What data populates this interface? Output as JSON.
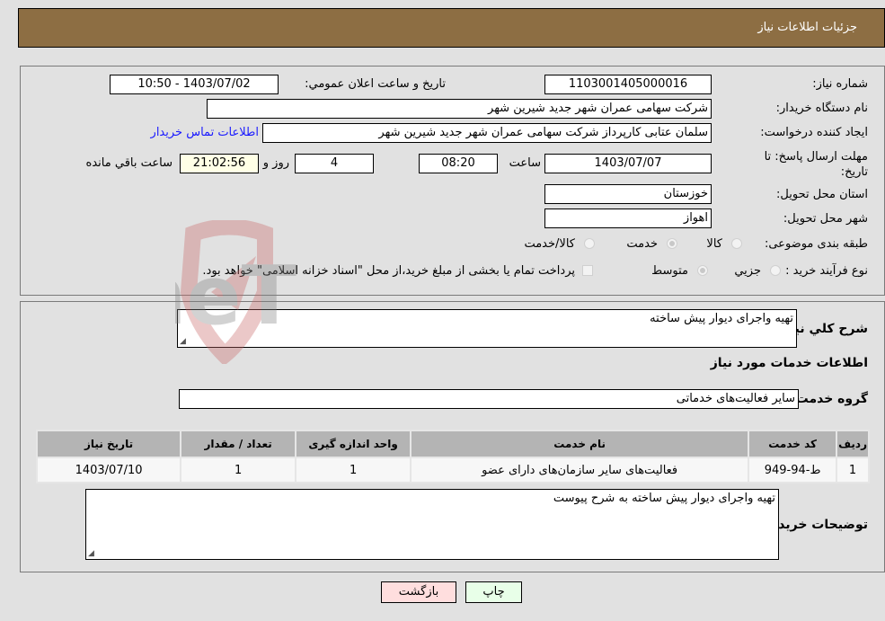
{
  "header": {
    "title": "جزئیات اطلاعات نیاز"
  },
  "need": {
    "number_label": "شماره نیاز:",
    "number": "1103001405000016",
    "announce_label": "تاریخ و ساعت اعلان عمومي:",
    "announce": "1403/07/02 - 10:50",
    "buyer_label": "نام دستگاه خریدار:",
    "buyer": "شرکت سهامی عمران شهر جدید شیرین شهر",
    "creator_label": "ایجاد کننده درخواست:",
    "creator": "سلمان عتابی کارپرداز شرکت سهامی عمران شهر جدید شیرین شهر",
    "contact_link": "اطلاعات تماس خریدار",
    "deadline_label": "مهلت ارسال پاسخ: تا تاریخ:",
    "deadline_date": "1403/07/07",
    "time_label": "ساعت",
    "deadline_time": "08:20",
    "days": "4",
    "days_label": "روز و",
    "remaining": "21:02:56",
    "remaining_label": "ساعت باقي مانده",
    "province_label": "استان محل تحویل:",
    "province": "خوزستان",
    "city_label": "شهر محل تحویل:",
    "city": "اهواز",
    "category_label": "طبقه بندی موضوعی:",
    "category_options": [
      "کالا",
      "خدمت",
      "کالا/خدمت"
    ],
    "category_selected": "خدمت",
    "process_label": "نوع فرآیند خرید :",
    "process_options": [
      "جزيي",
      "متوسط"
    ],
    "process_selected": "متوسط",
    "treasury_note": "پرداخت تمام یا بخشی از مبلغ خرید،از محل \"اسناد خزانه اسلامی\" خواهد بود.",
    "treasury_checked": false
  },
  "details": {
    "summary_label": "شرح كلي نياز:",
    "summary": "تهیه واجرای دیوار پیش ساخته",
    "services_heading": "اطلاعات خدمات مورد نیاز",
    "group_label": "گروه خدمت:",
    "group": "سایر فعالیت‌های خدماتی",
    "table": {
      "headers": [
        "ردیف",
        "کد خدمت",
        "نام خدمت",
        "واحد اندازه گیری",
        "تعداد / مقدار",
        "تاریخ نیاز"
      ],
      "rows": [
        [
          "1",
          "ط-94-949",
          "فعالیت‌های سایر سازمان‌های دارای عضو",
          "1",
          "1",
          "1403/07/10"
        ]
      ]
    },
    "buyer_notes_label": "توضیحات خریدار:",
    "buyer_notes": "تهیه واجرای دیوار پیش ساخته به شرح پیوست"
  },
  "buttons": {
    "print": "چاپ",
    "back": "بازگشت"
  },
  "watermark": {
    "text": "AriaTender.neT"
  },
  "colors": {
    "header_bg": "#8d6e43",
    "print_bg": "#e8ffe8",
    "back_bg": "#ffdede",
    "link": "#1a1aff"
  }
}
